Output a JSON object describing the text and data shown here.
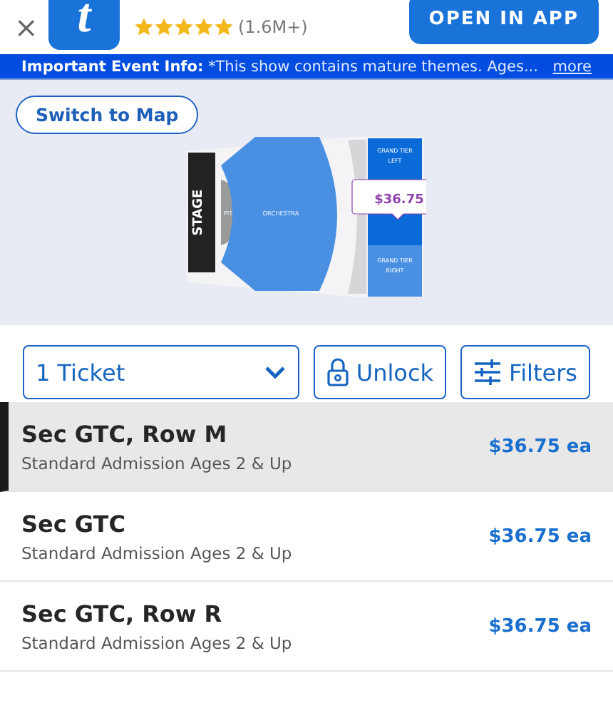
{
  "app_banner": {
    "close": "×",
    "logo": "t",
    "stars": 5,
    "review_count": "(1.6M+)",
    "button": "OPEN IN APP"
  },
  "info_bar": {
    "label": "Important Event Info:",
    "text": "*This show contains mature themes. Ages...",
    "link": "more"
  },
  "seat_map": {
    "button": "Switch to Map",
    "sections": [
      {
        "kind": "stage",
        "label": "STAGE"
      },
      {
        "kind": "pit",
        "label": "PIT"
      },
      {
        "kind": "orchestra",
        "label": "ORCHESTRA"
      },
      {
        "kind": "tier_left",
        "label": "GRAND TIER LEFT",
        "selected": true
      },
      {
        "kind": "tier_right",
        "label": "GRAND TIER RIGHT",
        "selected": false
      }
    ],
    "price_tag": "$36.75"
  },
  "controls": {
    "quantity": "1 Ticket",
    "unlock": "Unlock",
    "filters": "Filters"
  },
  "listings": [
    {
      "title": "Sec GTC, Row M",
      "subtitle": "Standard Admission Ages 2 & Up",
      "price": "$36.75 ea",
      "selected": true
    },
    {
      "title": "Sec GTC",
      "subtitle": "Standard Admission Ages 2 & Up",
      "price": "$36.75 ea",
      "selected": false
    },
    {
      "title": "Sec GTC, Row R",
      "subtitle": "Standard Admission Ages 2 & Up",
      "price": "$36.75 ea",
      "selected": false
    }
  ]
}
